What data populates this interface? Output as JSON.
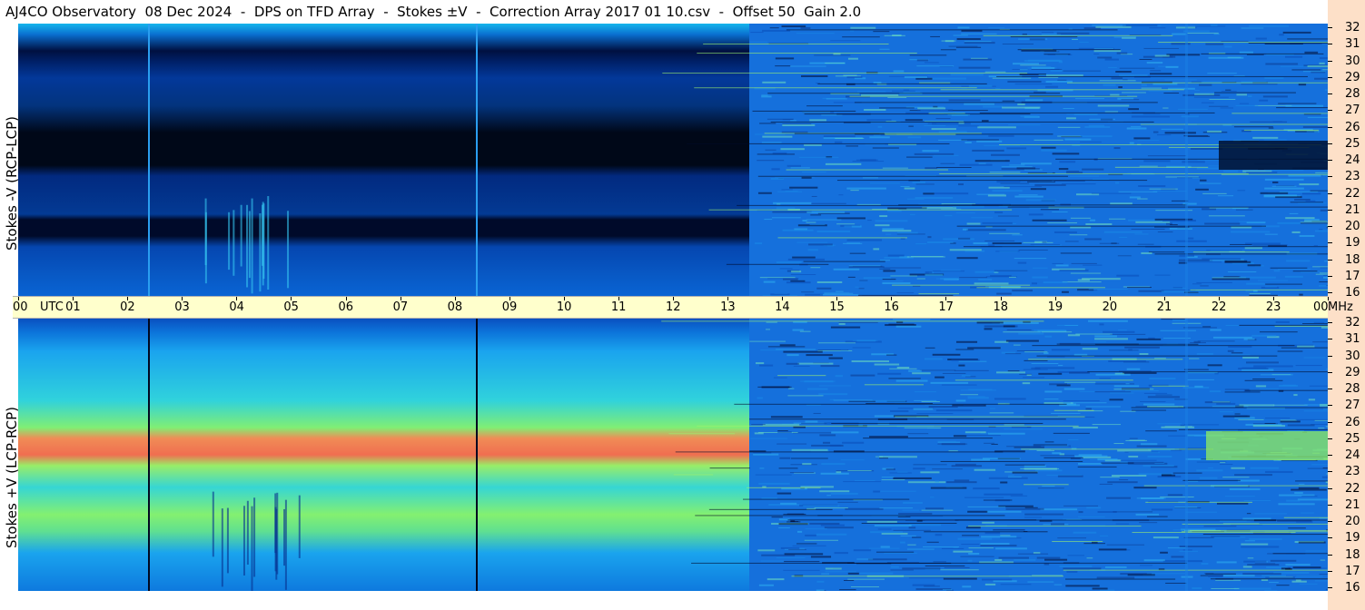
{
  "title": "AJ4CO Observatory  08 Dec 2024  -  DPS on TFD Array  -  Stokes ±V  -  Correction Array 2017 01 10.csv  -  Offset 50  Gain 2.0",
  "colors": {
    "background": "#ffffff",
    "time_axis_bg": "#ffffcc",
    "freq_axis_bg": "#fde0c8",
    "colormap": [
      "#000018",
      "#00207a",
      "#0060d0",
      "#1aa0f0",
      "#30d8e0",
      "#90f070",
      "#f0f040",
      "#f08060"
    ]
  },
  "chart_data": [
    {
      "type": "heatmap",
      "panel": "top",
      "ylabel": "Stokes -V (RCP-LCP)",
      "x_unit": "UTC",
      "y_unit": "MHz",
      "xlim": [
        "00",
        "00"
      ],
      "ylim": [
        16,
        32
      ],
      "x_ticks": [
        "00",
        "01",
        "02",
        "03",
        "04",
        "05",
        "06",
        "07",
        "08",
        "09",
        "10",
        "11",
        "12",
        "13",
        "14",
        "15",
        "16",
        "17",
        "18",
        "19",
        "20",
        "21",
        "22",
        "23",
        "00"
      ],
      "y_ticks": [
        "16",
        "17",
        "18",
        "19",
        "20",
        "21",
        "22",
        "23",
        "24",
        "25",
        "26",
        "27",
        "28",
        "29",
        "30",
        "31",
        "32"
      ],
      "dominant_level": "low (dark blue to black band near 24-25 MHz before 13.4 UTC)"
    },
    {
      "type": "heatmap",
      "panel": "bottom",
      "ylabel": "Stokes +V (LCP-RCP)",
      "x_unit": "UTC",
      "y_unit": "MHz",
      "xlim": [
        "00",
        "00"
      ],
      "ylim": [
        16,
        32
      ],
      "x_ticks": [
        "00",
        "01",
        "02",
        "03",
        "04",
        "05",
        "06",
        "07",
        "08",
        "09",
        "10",
        "11",
        "12",
        "13",
        "14",
        "15",
        "16",
        "17",
        "18",
        "19",
        "20",
        "21",
        "22",
        "23",
        "00"
      ],
      "y_ticks": [
        "16",
        "17",
        "18",
        "19",
        "20",
        "21",
        "22",
        "23",
        "24",
        "25",
        "26",
        "27",
        "28",
        "29",
        "30",
        "31",
        "32"
      ],
      "dominant_level": "high (orange band near 24-25 MHz before 13.4 UTC)"
    }
  ],
  "axis": {
    "utc_label": "UTC",
    "mhz_label": "MHz"
  }
}
